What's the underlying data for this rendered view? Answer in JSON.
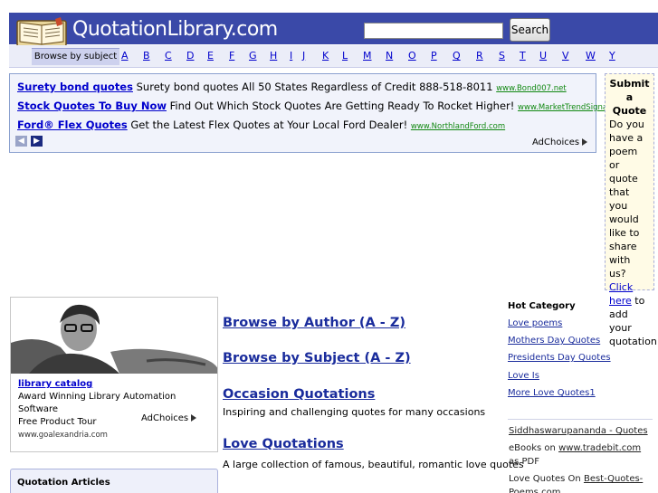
{
  "header": {
    "site_name": "QuotationLibrary.com",
    "logo_icon": "open-book-icon",
    "search_placeholder": "",
    "search_button": "Search",
    "brand_color": "#3a49a8"
  },
  "alphabet": {
    "browse_label": "Browse by subject",
    "letters": [
      "A",
      "B",
      "C",
      "D",
      "E",
      "F",
      "G",
      "H",
      "I",
      "J",
      "K",
      "L",
      "M",
      "N",
      "O",
      "P",
      "Q",
      "R",
      "S",
      "T",
      "U",
      "V",
      "W",
      "Y"
    ]
  },
  "ads": {
    "items": [
      {
        "title": "Surety bond quotes",
        "text": "Surety bond quotes All 50 States Regardless of Credit 888-518-8011",
        "url": "www.Bond007.net"
      },
      {
        "title": "Stock Quotes To Buy Now",
        "text": "Find Out Which Stock Quotes Are Getting Ready To Rocket Higher!",
        "url": "www.MarketTrendSignal.com"
      },
      {
        "title": "Ford® Flex Quotes",
        "text": "Get the Latest Flex Quotes at Your Local Ford Dealer!",
        "url": "www.NorthlandFord.com"
      }
    ],
    "adchoices": "AdChoices",
    "prev_icon": "chevron-left-icon",
    "next_icon": "chevron-right-icon"
  },
  "submit": {
    "title_1": "Submit",
    "title_2": "a Quote",
    "text_before": "Do you have a poem or quote that you would like to share with us?",
    "link": "Click here",
    "text_after": "to add your quotation"
  },
  "profile_ad": {
    "title": "library catalog",
    "line1": "Award Winning Library Automation Software",
    "line2": "Free Product Tour",
    "url": "www.goalexandria.com",
    "adchoices": "AdChoices"
  },
  "articles": {
    "title": "Quotation Articles"
  },
  "main": {
    "browse_author": "Browse by Author (A - Z)",
    "browse_subject": "Browse by Subject (A - Z)",
    "occasion_title": "Occasion Quotations",
    "occasion_desc": "Inspiring and challenging quotes for many occasions",
    "love_title": "Love Quotations",
    "love_desc": "A large collection of famous, beautiful, romantic love quotes"
  },
  "hot": {
    "title": "Hot Category",
    "items": [
      "Love poems",
      "Mothers Day Quotes",
      "Presidents Day Quotes",
      "Love Is",
      "More Love Quotes1"
    ]
  },
  "right": {
    "siddha": "Siddhaswarupananda - Quotes",
    "ebooks_pre": "eBooks on ",
    "ebooks_link": "www.tradebit.com",
    "ebooks_post": " as PDF",
    "lq_pre": "Love Quotes On ",
    "lq_link": "Best-Quotes-Poems.com"
  }
}
